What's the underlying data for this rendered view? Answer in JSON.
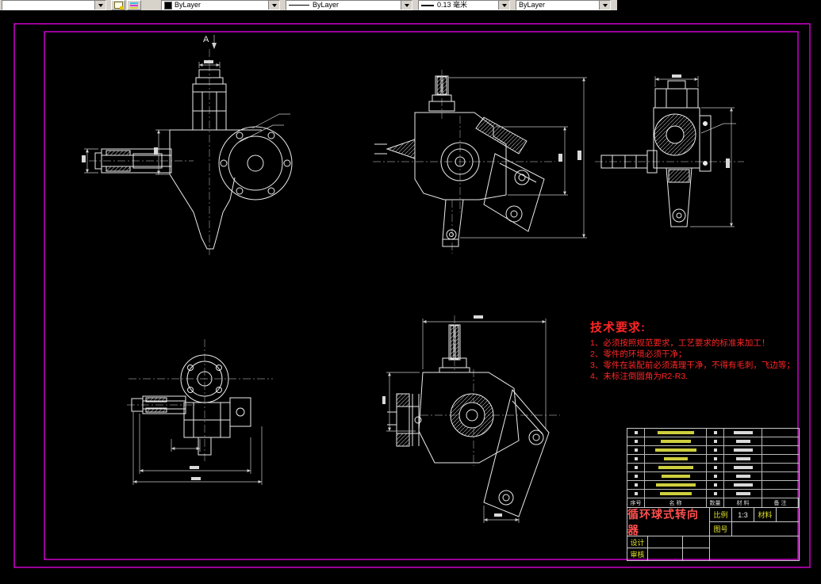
{
  "toolbar": {
    "layer": {
      "value": ""
    },
    "color": {
      "value": "ByLayer",
      "swatch": "#000000"
    },
    "linetype": {
      "value": "ByLayer"
    },
    "lineweight": {
      "value": "0.13 毫米"
    },
    "plot_style": {
      "value": "ByLayer"
    },
    "icons": {
      "dropdown": "chevron-down",
      "button1": "make-object-layer-current",
      "button2": "layer-properties"
    }
  },
  "drawing": {
    "section_label": "A",
    "views": [
      "front-view",
      "left-section-view",
      "side-view",
      "top-view",
      "sectional-view"
    ]
  },
  "tech_requirements": {
    "title": "技术要求:",
    "items": [
      "1、必须按照规范要求，工艺要求的标准来加工！",
      "2、零件的环境必须干净；",
      "3、零件在装配前必须清理干净，不得有毛刺，飞边等；",
      "4、未标注倒圆角为R2-R3."
    ]
  },
  "title_block": {
    "title": "循环球式转向器",
    "scale_label": "比例",
    "scale_value": "1:3",
    "material_label": "材料",
    "drawing_no_label": "图号",
    "designer_label": "设计",
    "reviewer_label": "审核",
    "header": {
      "index": "序号",
      "name": "名 称",
      "qty": "数量",
      "material": "材 料",
      "remark": "备 注"
    }
  },
  "colors": {
    "frame": "#ff00ff",
    "lines": "#e8e8e8",
    "tech_text": "#ff2626",
    "title_text": "#ff5050",
    "labels": "#e2e22a",
    "canvas_background": "#000000"
  }
}
